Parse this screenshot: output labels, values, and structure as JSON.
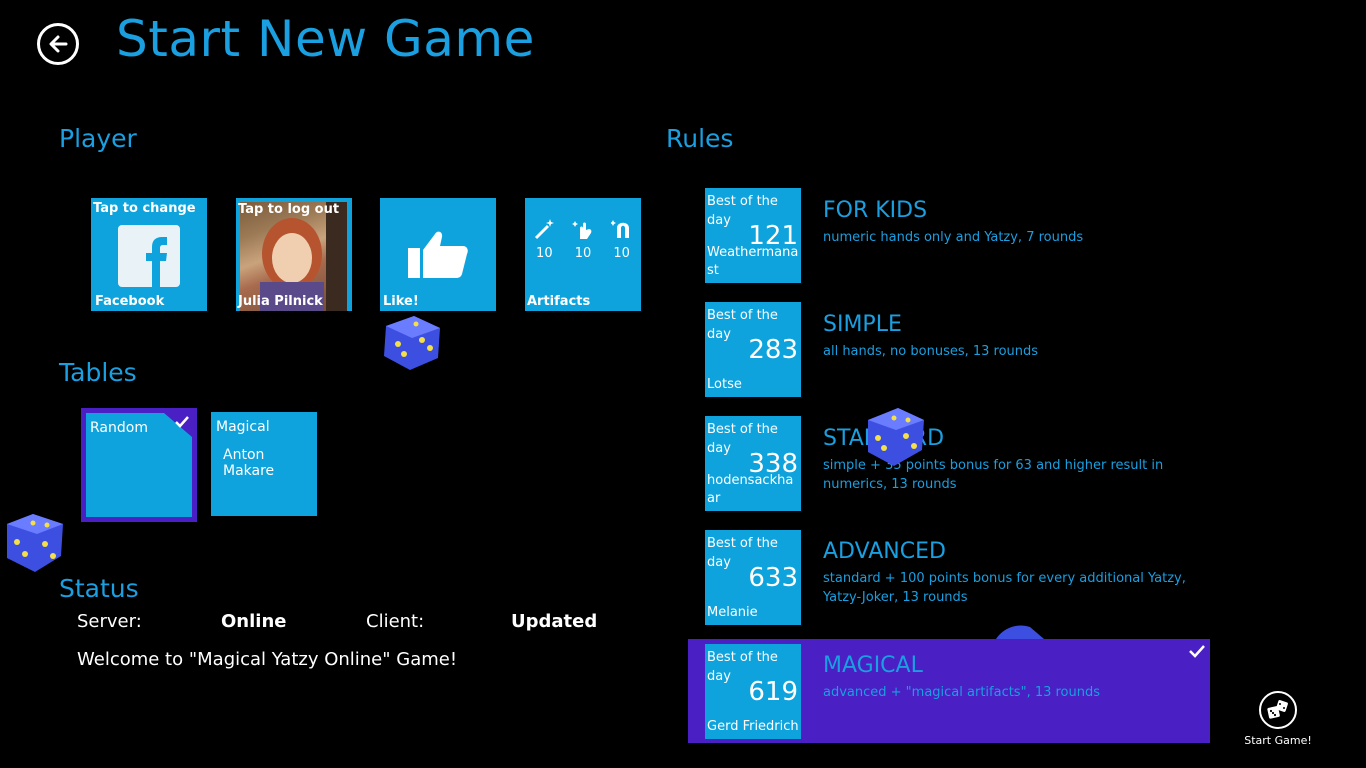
{
  "header": {
    "title": "Start New Game",
    "back_icon": "back-arrow-icon"
  },
  "player": {
    "section_title": "Player",
    "facebook_tile": {
      "top_label": "Tap to change",
      "bottom_label": "Facebook"
    },
    "profile_tile": {
      "top_label": "Tap to log out",
      "bottom_label": "Julia Pilnick"
    },
    "like_tile": {
      "bottom_label": "Like!"
    },
    "artifacts_tile": {
      "bottom_label": "Artifacts",
      "counts": [
        "10",
        "10",
        "10"
      ]
    }
  },
  "tables": {
    "section_title": "Tables",
    "items": [
      {
        "name": "Random",
        "player": "",
        "selected": true
      },
      {
        "name": "Magical",
        "player": "Anton Makare",
        "selected": false
      }
    ]
  },
  "status": {
    "section_title": "Status",
    "server_label": "Server:",
    "server_value": "Online",
    "client_label": "Client:",
    "client_value": "Updated",
    "welcome": "Welcome to \"Magical Yatzy Online\" Game!"
  },
  "rules": {
    "section_title": "Rules",
    "items": [
      {
        "best_label": "Best of the day",
        "score": "121",
        "winner": "Weathermanast",
        "name": "FOR KIDS",
        "desc": "numeric hands only and Yatzy, 7 rounds",
        "selected": false
      },
      {
        "best_label": "Best of the day",
        "score": "283",
        "winner": "Lotse",
        "name": "SIMPLE",
        "desc": "all hands, no bonuses, 13 rounds",
        "selected": false
      },
      {
        "best_label": "Best of the day",
        "score": "338",
        "winner": "hodensackhaar",
        "name": "STANDARD",
        "desc": "simple + 35 points bonus for 63 and higher result in numerics, 13 rounds",
        "selected": false
      },
      {
        "best_label": "Best of the day",
        "score": "633",
        "winner": "Melanie",
        "name": "ADVANCED",
        "desc": "standard + 100 points bonus for every additional Yatzy, Yatzy-Joker, 13 rounds",
        "selected": false
      },
      {
        "best_label": "Best of the day",
        "score": "619",
        "winner": "Gerd Friedrich",
        "name": "MAGICAL",
        "desc": "advanced + \"magical artifacts\", 13 rounds",
        "selected": true
      }
    ]
  },
  "start": {
    "label": "Start Game!"
  },
  "colors": {
    "accent": "#1a9fe0",
    "tile": "#0ea3dc",
    "selected": "#4a1fc4",
    "background": "#000000"
  }
}
